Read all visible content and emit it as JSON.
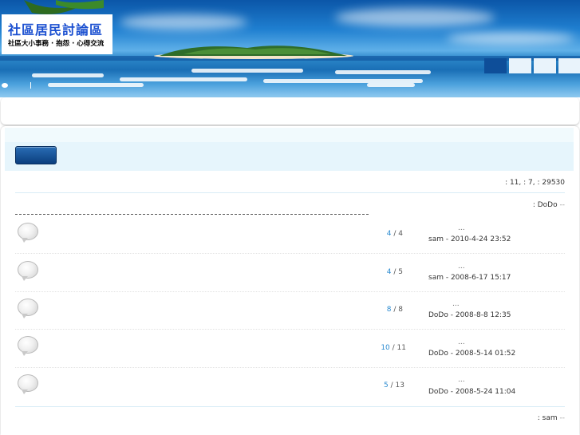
{
  "header": {
    "logo_title": "社區居民討論區",
    "logo_subtitle": "社區大小事務 · 抱怨 · 心得交流"
  },
  "stats": {
    "text": ": 11,  : 7,  : 29530"
  },
  "moderator": {
    "prefix": ":",
    "name": "DoDo",
    "suffix": "--"
  },
  "topics": [
    {
      "replies": "4",
      "views": "4",
      "ellipsis": "...",
      "last_post": "sam - 2010-4-24 23:52"
    },
    {
      "replies": "4",
      "views": "5",
      "ellipsis": "...",
      "last_post": "sam - 2008-6-17 15:17"
    },
    {
      "replies": "8",
      "views": "8",
      "ellipsis": "...",
      "last_post": "DoDo - 2008-8-8 12:35"
    },
    {
      "replies": "10",
      "views": "11",
      "ellipsis": "...",
      "last_post": "DoDo - 2008-5-14 01:52"
    },
    {
      "replies": "5",
      "views": "13",
      "ellipsis": "...",
      "last_post": "DoDo - 2008-5-24 11:04"
    }
  ],
  "bottom": {
    "prefix": ":",
    "name": "sam",
    "suffix": "--"
  },
  "colors": {
    "accent": "#2a8ad0",
    "nav_active": "#0e4e99",
    "band": "#e6f5fc"
  }
}
